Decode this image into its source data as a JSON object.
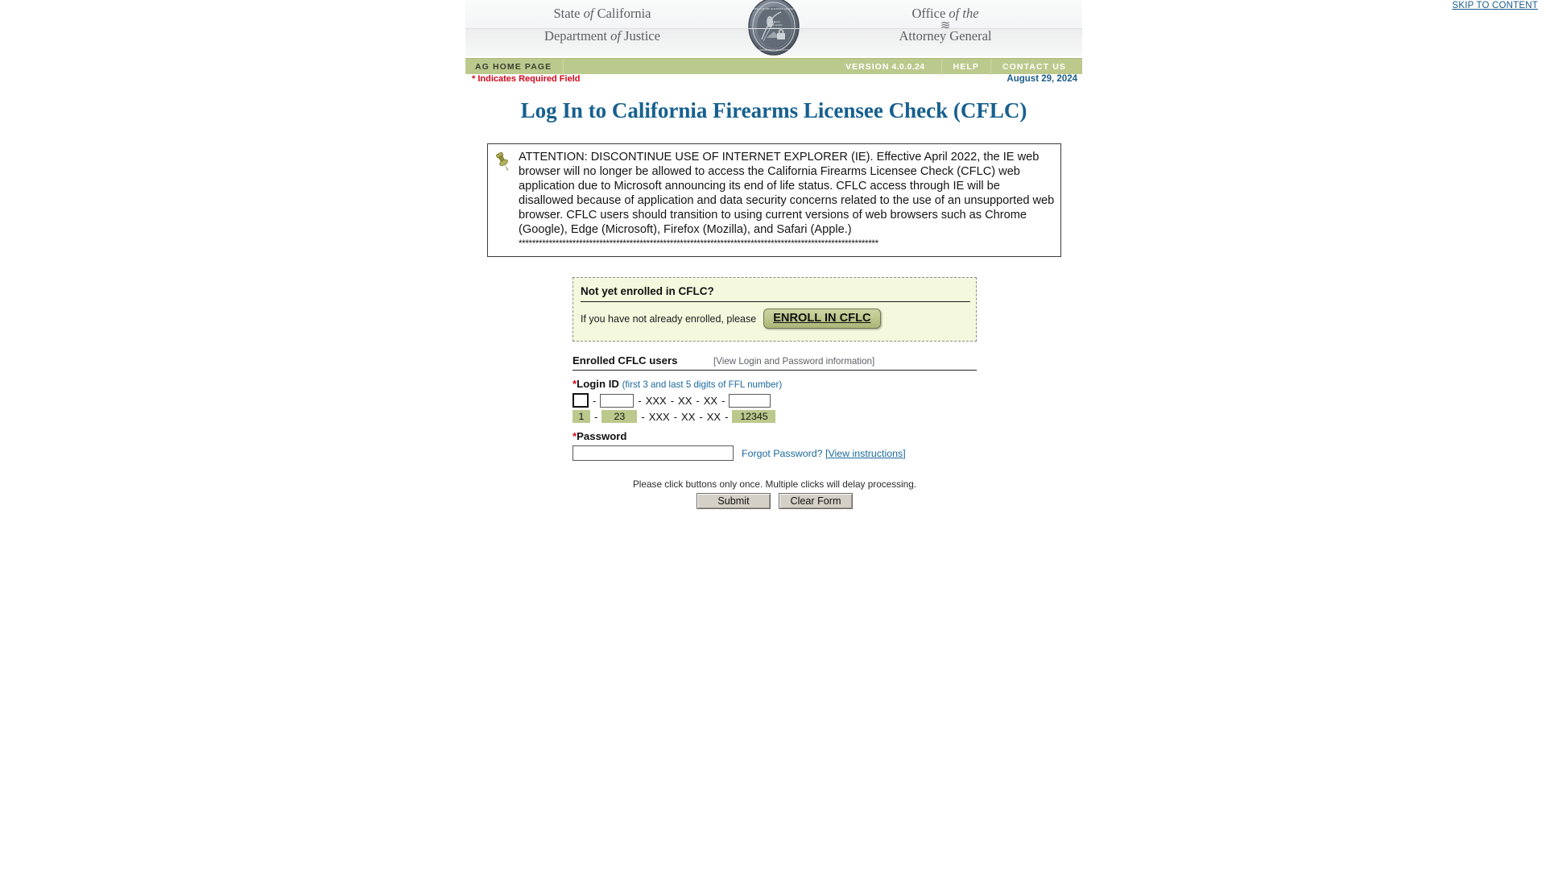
{
  "masthead": {
    "skip_link": "SKIP TO CONTENT",
    "left_line1": "State of California",
    "left_line1_plain": "State",
    "left_line1_em": "of",
    "left_line1_rest": "California",
    "left_line2_plain": "Department",
    "left_line2_em": "of",
    "left_line2_rest": "Justice",
    "right_line1_plain": "Office",
    "right_line1_em": "of the",
    "right_line2": "Attorney General",
    "squiggle": "≋",
    "seal_alt": "california-doj-seal"
  },
  "navbar": {
    "home": "AG HOME PAGE",
    "version_label": "VERSION",
    "version_number": "4.0.0.24",
    "help": "HELP",
    "contact": "CONTACT US",
    "bg_color": "#bcc98d"
  },
  "subbar": {
    "required_note": "* Indicates Required Field",
    "date": "August 29, 2024",
    "required_color": "#d3071b",
    "date_color": "#1b5e8b"
  },
  "page_title": {
    "text": "Log In to California Firearms Licensee Check (CFLC)",
    "color": "#16608f"
  },
  "alert": {
    "icon": "pushpin-icon",
    "text": "ATTENTION: DISCONTINUE USE OF INTERNET EXPLORER (IE). Effective April 2022, the IE web browser will no longer be allowed to access the California Firearms Licensee Check (CFLC) web application due to Microsoft announcing its end of life status. CFLC access through IE will be disallowed because of application and data security concerns related to the use of an unsupported web browser. CFLC users should transition to using current versions of web browsers such as Chrome (Google), Edge (Microsoft), Firefox (Mozilla), and Safari (Apple.)",
    "separator": "***********************************************************************************************************"
  },
  "enroll": {
    "title": "Not yet enrolled in CFLC?",
    "text": "If you have not already enrolled, please",
    "button": "ENROLL IN CFLC",
    "bg_color": "#f4f8dd"
  },
  "login_form": {
    "section_label": "Enrolled CFLC users",
    "section_link": "[View Login and Password information]",
    "login_id_label": "Login ID",
    "login_id_hint": "(first 3 and last 5 digits of FFL number)",
    "required_marker": "*",
    "id_part1_value": "",
    "id_part2_value": "",
    "id_part3_value": "",
    "sep_dash": "-",
    "fixed_xxx": "XXX",
    "fixed_xx_1": "XX",
    "fixed_xx_2": "XX",
    "example_part1": "1",
    "example_part2": "23",
    "example_xxx": "XXX",
    "example_xx_1": "XX",
    "example_xx_2": "XX",
    "example_part3": "12345",
    "password_label": "Password",
    "password_value": "",
    "forgot_text": "Forgot Password?",
    "forgot_bracket_open": "[",
    "forgot_link": "View instructions",
    "forgot_bracket_close": "]",
    "notice": "Please click buttons only once. Multiple clicks will delay processing.",
    "submit_button": "Submit",
    "clear_button": "Clear Form"
  }
}
